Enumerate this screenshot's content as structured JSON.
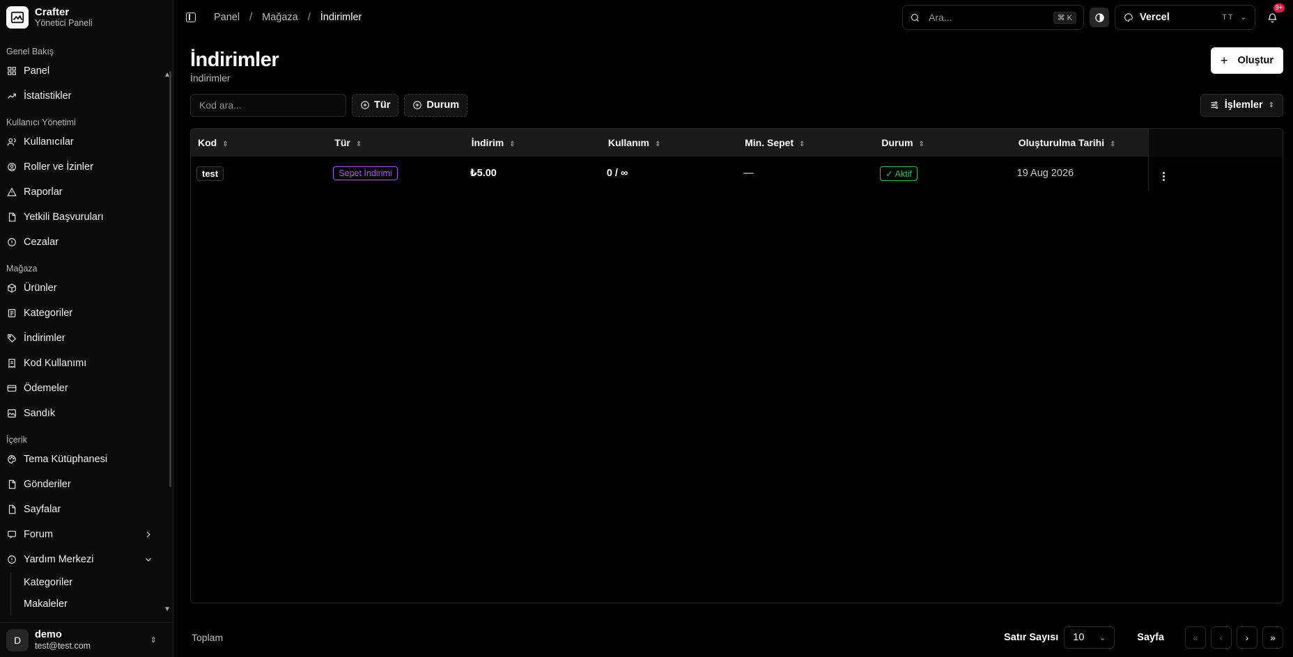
{
  "brand": {
    "title": "Crafter",
    "subtitle": "Yönetici Paneli"
  },
  "sidebar": {
    "groups": [
      {
        "label": "Genel Bakış",
        "items": [
          {
            "label": "Panel",
            "icon": "dashboard-icon"
          },
          {
            "label": "İstatistikler",
            "icon": "trending-up-icon"
          }
        ]
      },
      {
        "label": "Kullanıcı Yönetimi",
        "items": [
          {
            "label": "Kullanıcılar",
            "icon": "users-icon"
          },
          {
            "label": "Roller ve İzinler",
            "icon": "user-circle-icon"
          },
          {
            "label": "Raporlar",
            "icon": "warning-icon"
          },
          {
            "label": "Yetkili Başvuruları",
            "icon": "file-icon"
          },
          {
            "label": "Cezalar",
            "icon": "info-icon"
          }
        ]
      },
      {
        "label": "Mağaza",
        "items": [
          {
            "label": "Ürünler",
            "icon": "package-icon"
          },
          {
            "label": "Kategoriler",
            "icon": "list-icon"
          },
          {
            "label": "İndirimler",
            "icon": "tag-icon"
          },
          {
            "label": "Kod Kullanımı",
            "icon": "receipt-icon"
          },
          {
            "label": "Ödemeler",
            "icon": "credit-card-icon"
          },
          {
            "label": "Sandık",
            "icon": "image-icon"
          }
        ]
      },
      {
        "label": "İçerik",
        "items": [
          {
            "label": "Tema Kütüphanesi",
            "icon": "palette-icon"
          },
          {
            "label": "Gönderiler",
            "icon": "file-icon"
          },
          {
            "label": "Sayfalar",
            "icon": "file-icon"
          },
          {
            "label": "Forum",
            "icon": "message-icon",
            "chevron": "right"
          },
          {
            "label": "Yardım Merkezi",
            "icon": "info-icon",
            "chevron": "down"
          }
        ]
      }
    ],
    "help_sub": [
      "Kategoriler",
      "Makaleler"
    ]
  },
  "user": {
    "initial": "D",
    "name": "demo",
    "email": "test@test.com"
  },
  "breadcrumb": [
    "Panel",
    "Mağaza",
    "İndirimler"
  ],
  "search": {
    "placeholder": "Ara...",
    "shortcut": "⌘ K"
  },
  "team": {
    "name": "Vercel",
    "code": "TT"
  },
  "notifications": {
    "badge": "9+"
  },
  "page": {
    "title": "İndirimler",
    "subtitle": "İndirimler",
    "create_label": "Oluştur"
  },
  "filters": {
    "search_placeholder": "Kod ara...",
    "type_label": "Tür",
    "status_label": "Durum",
    "actions_label": "İşlemler"
  },
  "table": {
    "columns": [
      "Kod",
      "Tür",
      "İndirim",
      "Kullanım",
      "Min. Sepet",
      "Durum",
      "Oluşturulma Tarihi"
    ],
    "rows": [
      {
        "code": "test",
        "type": "Sepet İndirimi",
        "discount": "₺5.00",
        "usage": "0 / ∞",
        "min_cart": "—",
        "status": "Aktif",
        "created": "19 Aug 2026"
      }
    ]
  },
  "footer": {
    "total_label": "Toplam",
    "rows_label": "Satır Sayısı",
    "rows_value": "10",
    "page_label": "Sayfa"
  },
  "colors": {
    "type_badge": "#a855f7",
    "status_badge": "#22c55e",
    "notification": "#e11d48"
  }
}
